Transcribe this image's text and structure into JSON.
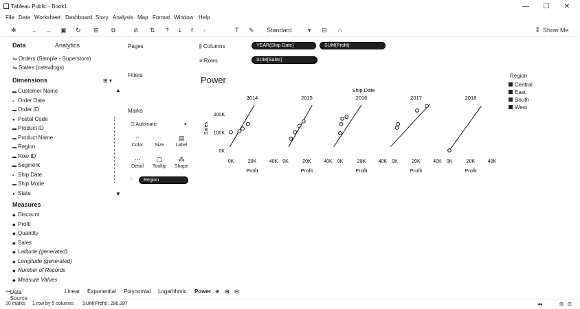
{
  "window": {
    "title": "Tableau Public - Book1",
    "buttons": [
      "—",
      "☐",
      "✕"
    ]
  },
  "menu": [
    "File",
    "Data",
    "Worksheet",
    "Dashboard",
    "Story",
    "Analysis",
    "Map",
    "Format",
    "Window",
    "Help"
  ],
  "toolbar": {
    "fit_value": "Standard",
    "show_me_label": "Show Me"
  },
  "side_panel": {
    "tab_data": "Data",
    "tab_analytics": "Analytics",
    "data_sources": [
      "Orders (Sample - Superstore)",
      "States (catsvdogs)"
    ],
    "dimensions_title": "Dimensions",
    "dimensions": [
      {
        "label": "Customer Name",
        "icon": "Abc"
      },
      {
        "label": "Order Date",
        "icon": "date"
      },
      {
        "label": "Order ID",
        "icon": "Abc"
      },
      {
        "label": "Postal Code",
        "icon": "geo"
      },
      {
        "label": "Product ID",
        "icon": "Abc"
      },
      {
        "label": "Product Name",
        "icon": "Abc"
      },
      {
        "label": "Region",
        "icon": "Abc"
      },
      {
        "label": "Row ID",
        "icon": "Abc"
      },
      {
        "label": "Segment",
        "icon": "Abc"
      },
      {
        "label": "Ship Date",
        "icon": "date"
      },
      {
        "label": "Ship Mode",
        "icon": "Abc"
      },
      {
        "label": "State",
        "icon": "geo"
      }
    ],
    "measures_title": "Measures",
    "measures": [
      {
        "label": "Discount",
        "italic": false
      },
      {
        "label": "Profit",
        "italic": false
      },
      {
        "label": "Quantity",
        "italic": false
      },
      {
        "label": "Sales",
        "italic": false
      },
      {
        "label": "Latitude (generated)",
        "italic": true
      },
      {
        "label": "Longitude (generated)",
        "italic": true
      },
      {
        "label": "Number of Records",
        "italic": true
      },
      {
        "label": "Measure Values",
        "italic": true
      }
    ]
  },
  "cards": {
    "pages": "Pages",
    "filters": "Filters",
    "marks": "Marks",
    "mark_type": "Automatic",
    "marks_buttons": [
      "Color",
      "Size",
      "Label",
      "Detail",
      "Tooltip",
      "Shape"
    ],
    "marks_pill": "Region"
  },
  "shelves": {
    "columns_label": "Columns",
    "rows_label": "Rows",
    "columns_pills": [
      "YEAR(Ship Date)",
      "SUM(Profit)"
    ],
    "rows_pills": [
      "SUM(Sales)"
    ]
  },
  "view": {
    "title": "Power"
  },
  "legend": {
    "title": "Region",
    "items": [
      "Central",
      "East",
      "South",
      "West"
    ]
  },
  "bottom_tabs": [
    "Data Source",
    "Linear",
    "Exponential",
    "Polynomial",
    "Logarithmic",
    "Power"
  ],
  "status": {
    "marks": "20 marks",
    "rows_cols": "1 row by 5 columns",
    "sum": "SUM(Profit): 286,397"
  },
  "chart_data": {
    "type": "scatter",
    "title": "",
    "header": "Ship Date",
    "panels": [
      "2014",
      "2015",
      "2016",
      "2017",
      "2018"
    ],
    "xlabel": "Profit",
    "ylabel": "Sales",
    "x_ticks": [
      "0K",
      "20K",
      "40K"
    ],
    "y_ticks": [
      "0K",
      "100K",
      "200K"
    ],
    "xlim": [
      0,
      40000
    ],
    "ylim": [
      0,
      250000
    ],
    "trend": "power",
    "points": [
      [
        [
          0,
          100000
        ],
        [
          8000,
          105000
        ],
        [
          11000,
          120000
        ],
        [
          16000,
          145000
        ]
      ],
      [
        [
          5000,
          65000
        ],
        [
          9000,
          100000
        ],
        [
          13000,
          135000
        ],
        [
          17000,
          160000
        ]
      ],
      [
        [
          0,
          95000
        ],
        [
          1000,
          145000
        ],
        [
          2000,
          175000
        ],
        [
          6000,
          185000
        ]
      ],
      [
        [
          2000,
          125000
        ],
        [
          3000,
          145000
        ],
        [
          21000,
          220000
        ],
        [
          30000,
          245000
        ]
      ],
      [
        [
          0,
          0
        ]
      ]
    ],
    "trend_lines": [
      [
        [
          -1000,
          20000
        ],
        [
          22000,
          250000
        ]
      ],
      [
        [
          3000,
          20000
        ],
        [
          25000,
          250000
        ]
      ],
      [
        [
          -6000,
          20000
        ],
        [
          20000,
          250000
        ]
      ],
      [
        [
          -4000,
          20000
        ],
        [
          33000,
          255000
        ]
      ],
      [
        [
          0,
          0
        ],
        [
          30000,
          245000
        ]
      ]
    ]
  }
}
